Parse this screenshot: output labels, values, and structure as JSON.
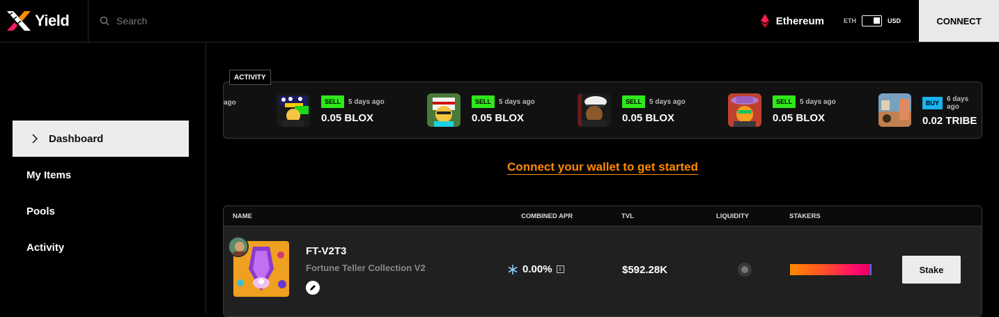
{
  "header": {
    "brand": "Yield",
    "search_placeholder": "Search",
    "network": "Ethereum",
    "currency_left": "ETH",
    "currency_right": "USD",
    "connect_label": "CONNECT"
  },
  "sidebar": {
    "items": [
      {
        "label": "Dashboard",
        "active": true
      },
      {
        "label": "My Items",
        "active": false
      },
      {
        "label": "Pools",
        "active": false
      },
      {
        "label": "Activity",
        "active": false
      }
    ]
  },
  "activity": {
    "tag": "ACTIVITY",
    "partial_time": "ago",
    "items": [
      {
        "type": "SELL",
        "time": "5 days ago",
        "amount": "0.05 BLOX"
      },
      {
        "type": "SELL",
        "time": "5 days ago",
        "amount": "0.05 BLOX"
      },
      {
        "type": "SELL",
        "time": "5 days ago",
        "amount": "0.05 BLOX"
      },
      {
        "type": "SELL",
        "time": "5 days ago",
        "amount": "0.05 BLOX"
      },
      {
        "type": "BUY",
        "time": "6 days ago",
        "amount": "0.02 TRIBE"
      }
    ],
    "colors": {
      "sell": "#2ee81a",
      "buy": "#18b4f0"
    }
  },
  "cta": {
    "label": "Connect your wallet to get started"
  },
  "table": {
    "columns": [
      "NAME",
      "COMBINED APR",
      "TVL",
      "LIQUIDITY",
      "STAKERS"
    ],
    "rows": [
      {
        "name": "FT-V2T3",
        "collection": "Fortune Teller Collection V2",
        "apr": "0.00%",
        "tvl": "$592.28K",
        "stake_label": "Stake"
      }
    ]
  },
  "colors": {
    "accent": "#ff8a00",
    "background": "#000000"
  }
}
